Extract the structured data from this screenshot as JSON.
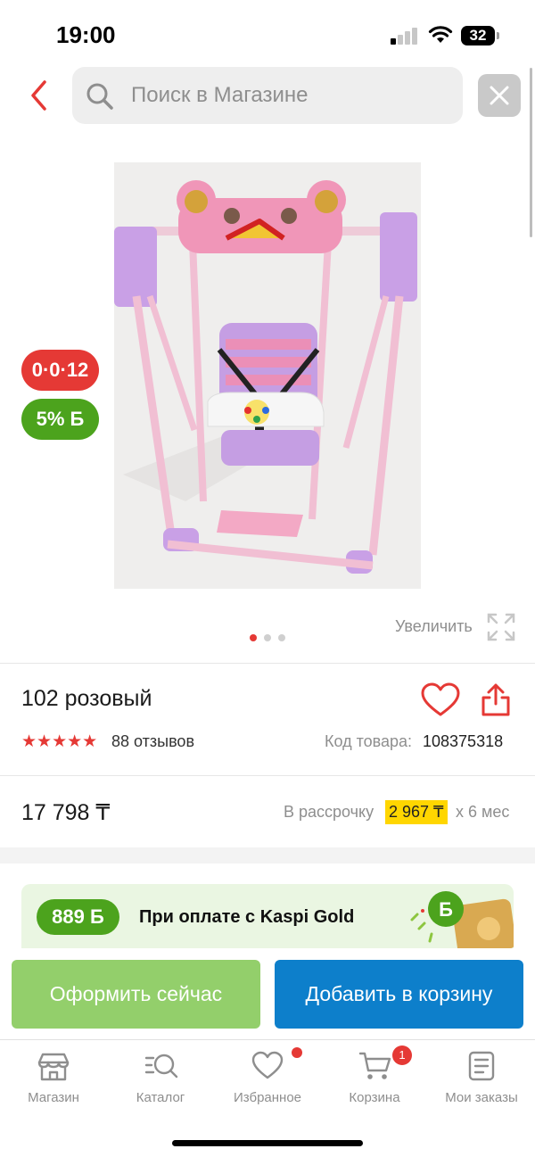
{
  "status_bar": {
    "time": "19:00",
    "battery": "32"
  },
  "search": {
    "placeholder": "Поиск в Магазине"
  },
  "product": {
    "badge_installment": "0·0·12",
    "badge_bonus": "5% Б",
    "zoom_label": "Увеличить",
    "image_count": 3,
    "active_image": 1,
    "title": "102 розовый",
    "rating": 5,
    "stars": "★★★★★",
    "reviews": "88 отзывов",
    "sku_label": "Код товара:",
    "sku_value": "108375318",
    "price": "17 798 ₸",
    "installment_label": "В рассрочку",
    "installment_amount": "2 967 ₸",
    "installment_term": "x 6 мес"
  },
  "promo": {
    "bonus": "889 Б",
    "text": "При оплате с Kaspi Gold"
  },
  "actions": {
    "checkout": "Оформить сейчас",
    "add_to_cart": "Добавить в корзину"
  },
  "tabs": [
    {
      "label": "Магазин",
      "icon": "store-icon"
    },
    {
      "label": "Каталог",
      "icon": "catalog-search-icon"
    },
    {
      "label": "Избранное",
      "icon": "heart-icon"
    },
    {
      "label": "Корзина",
      "icon": "cart-icon",
      "badge": "1"
    },
    {
      "label": "Мои заказы",
      "icon": "orders-icon"
    }
  ],
  "colors": {
    "accent_red": "#e53935",
    "kaspi_green": "#4ca31d",
    "cart_blue": "#0d7fcb",
    "checkout_green": "#93cf6b",
    "highlight_yellow": "#ffd600"
  }
}
